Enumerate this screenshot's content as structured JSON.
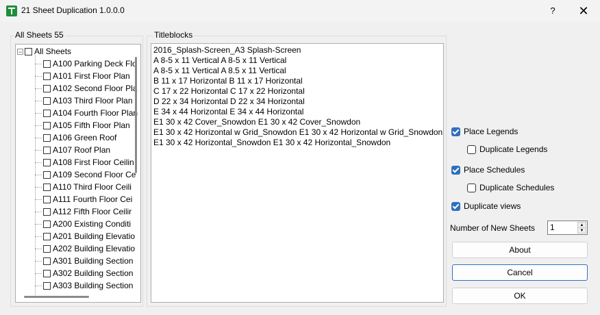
{
  "window": {
    "title": "21 Sheet Duplication 1.0.0.0",
    "help_label": "?",
    "close_glyph": "✕"
  },
  "sheets_group": {
    "label": "All Sheets 55",
    "root_label": "All Sheets",
    "root_expander": "−",
    "items": [
      {
        "label": "A100 Parking Deck Flo"
      },
      {
        "label": "A101 First Floor Plan"
      },
      {
        "label": "A102 Second Floor Pla"
      },
      {
        "label": "A103 Third Floor Plan"
      },
      {
        "label": "A104 Fourth Floor Plan"
      },
      {
        "label": "A105 Fifth Floor Plan"
      },
      {
        "label": "A106 Green Roof"
      },
      {
        "label": "A107 Roof Plan"
      },
      {
        "label": "A108 First Floor Ceilin"
      },
      {
        "label": "A109 Second Floor Ce"
      },
      {
        "label": "A110 Third Floor Ceili"
      },
      {
        "label": "A111 Fourth Floor Cei"
      },
      {
        "label": "A112 Fifth Floor Ceilir"
      },
      {
        "label": "A200 Existing Conditi"
      },
      {
        "label": "A201 Building Elevatio"
      },
      {
        "label": "A202 Building Elevatio"
      },
      {
        "label": "A301 Building Section"
      },
      {
        "label": "A302 Building Section"
      },
      {
        "label": "A303 Building Section"
      }
    ]
  },
  "titleblocks_group": {
    "label": "Titleblocks",
    "items": [
      "2016_Splash-Screen_A3 Splash-Screen",
      "A 8-5 x 11 Vertical A 8-5 x 11 Vertical",
      "A 8-5 x 11 Vertical A 8.5 x 11 Vertical",
      "B 11 x 17 Horizontal B 11 x 17 Horizontal",
      "C 17 x 22 Horizontal C 17 x 22 Horizontal",
      "D 22 x 34 Horizontal D 22 x 34 Horizontal",
      "E 34 x 44 Horizontal E 34 x 44 Horizontal",
      "E1 30 x 42 Cover_Snowdon E1 30 x 42 Cover_Snowdon",
      "E1 30 x 42 Horizontal w Grid_Snowdon E1 30 x 42 Horizontal w Grid_Snowdon",
      "E1 30 x 42 Horizontal_Snowdon E1 30 x 42 Horizontal_Snowdon"
    ]
  },
  "options": {
    "place_legends": {
      "label": "Place Legends",
      "checked": true
    },
    "duplicate_legends": {
      "label": "Duplicate Legends",
      "checked": false
    },
    "place_schedules": {
      "label": "Place Schedules",
      "checked": true
    },
    "duplicate_schedules": {
      "label": "Duplicate Schedules",
      "checked": false
    },
    "duplicate_views": {
      "label": "Duplicate views",
      "checked": true
    }
  },
  "new_sheets": {
    "label": "Number of New Sheets",
    "value": "1",
    "up_glyph": "▲",
    "down_glyph": "▼"
  },
  "buttons": {
    "about": "About",
    "cancel": "Cancel",
    "ok": "OK"
  },
  "colors": {
    "accent": "#2f6fbf",
    "app_icon": "#1d8f3a"
  }
}
